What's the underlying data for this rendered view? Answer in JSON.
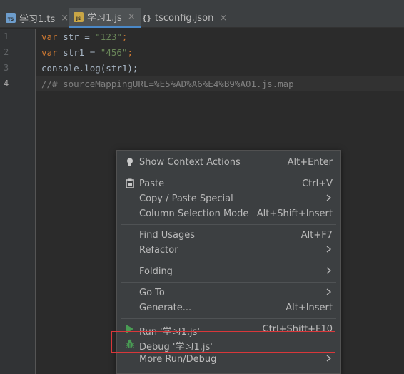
{
  "tabs": [
    {
      "label": "学习1.ts",
      "icon": "typescript-file-icon",
      "active": false
    },
    {
      "label": "学习1.js",
      "icon": "javascript-file-icon",
      "active": true
    },
    {
      "label": "tsconfig.json",
      "icon": "json-file-icon",
      "active": false
    }
  ],
  "close_glyph": "×",
  "editor": {
    "line_numbers": [
      "1",
      "2",
      "3",
      "4"
    ],
    "current_line": 4,
    "lines": [
      {
        "kw": "var",
        "rest": " str = ",
        "str": "\"123\"",
        "end": ";"
      },
      {
        "kw": "var",
        "rest": " str1 = ",
        "str": "\"456\"",
        "end": ";"
      },
      {
        "plain": "console.log(str1);"
      },
      {
        "comment": "//# sourceMappingURL=%E5%AD%A6%E4%B9%A01.js.map"
      }
    ]
  },
  "colors": {
    "keyword": "#cc7832",
    "string": "#6a8759",
    "comment": "#808080",
    "highlight_border": "#d9373a",
    "run_icon": "#499c54"
  },
  "context_menu": {
    "items": [
      {
        "label": "Show Context Actions",
        "shortcut": "Alt+Enter",
        "icon": "lightbulb-icon"
      },
      {
        "label": "Paste",
        "shortcut": "Ctrl+V",
        "icon": "clipboard-icon"
      },
      {
        "label": "Copy / Paste Special",
        "submenu": true
      },
      {
        "label": "Column Selection Mode",
        "shortcut": "Alt+Shift+Insert"
      },
      {
        "label": "Find Usages",
        "shortcut": "Alt+F7"
      },
      {
        "label": "Refactor",
        "submenu": true
      },
      {
        "label": "Folding",
        "submenu": true
      },
      {
        "label": "Go To",
        "submenu": true
      },
      {
        "label": "Generate...",
        "shortcut": "Alt+Insert"
      },
      {
        "label": "Run '学习1.js'",
        "shortcut": "Ctrl+Shift+F10",
        "icon": "run-icon"
      },
      {
        "label": "Debug '学习1.js'",
        "icon": "debug-bug-icon",
        "highlighted": true
      },
      {
        "label": "More Run/Debug",
        "submenu": true
      }
    ]
  }
}
